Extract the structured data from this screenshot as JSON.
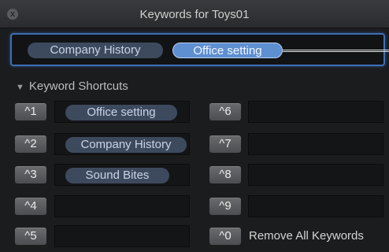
{
  "window": {
    "title": "Keywords for Toys01",
    "close_glyph": "x"
  },
  "keyword_field": {
    "tokens": [
      "Company History",
      "Office setting"
    ]
  },
  "shortcuts": {
    "header": "Keyword Shortcuts",
    "left": [
      {
        "key": "^1",
        "keyword": "Office setting"
      },
      {
        "key": "^2",
        "keyword": "Company History"
      },
      {
        "key": "^3",
        "keyword": "Sound Bites"
      },
      {
        "key": "^4",
        "keyword": ""
      },
      {
        "key": "^5",
        "keyword": ""
      }
    ],
    "right": [
      {
        "key": "^6",
        "keyword": ""
      },
      {
        "key": "^7",
        "keyword": ""
      },
      {
        "key": "^8",
        "keyword": ""
      },
      {
        "key": "^9",
        "keyword": ""
      }
    ],
    "remove_all": {
      "key": "^0",
      "label": "Remove All Keywords"
    }
  }
}
